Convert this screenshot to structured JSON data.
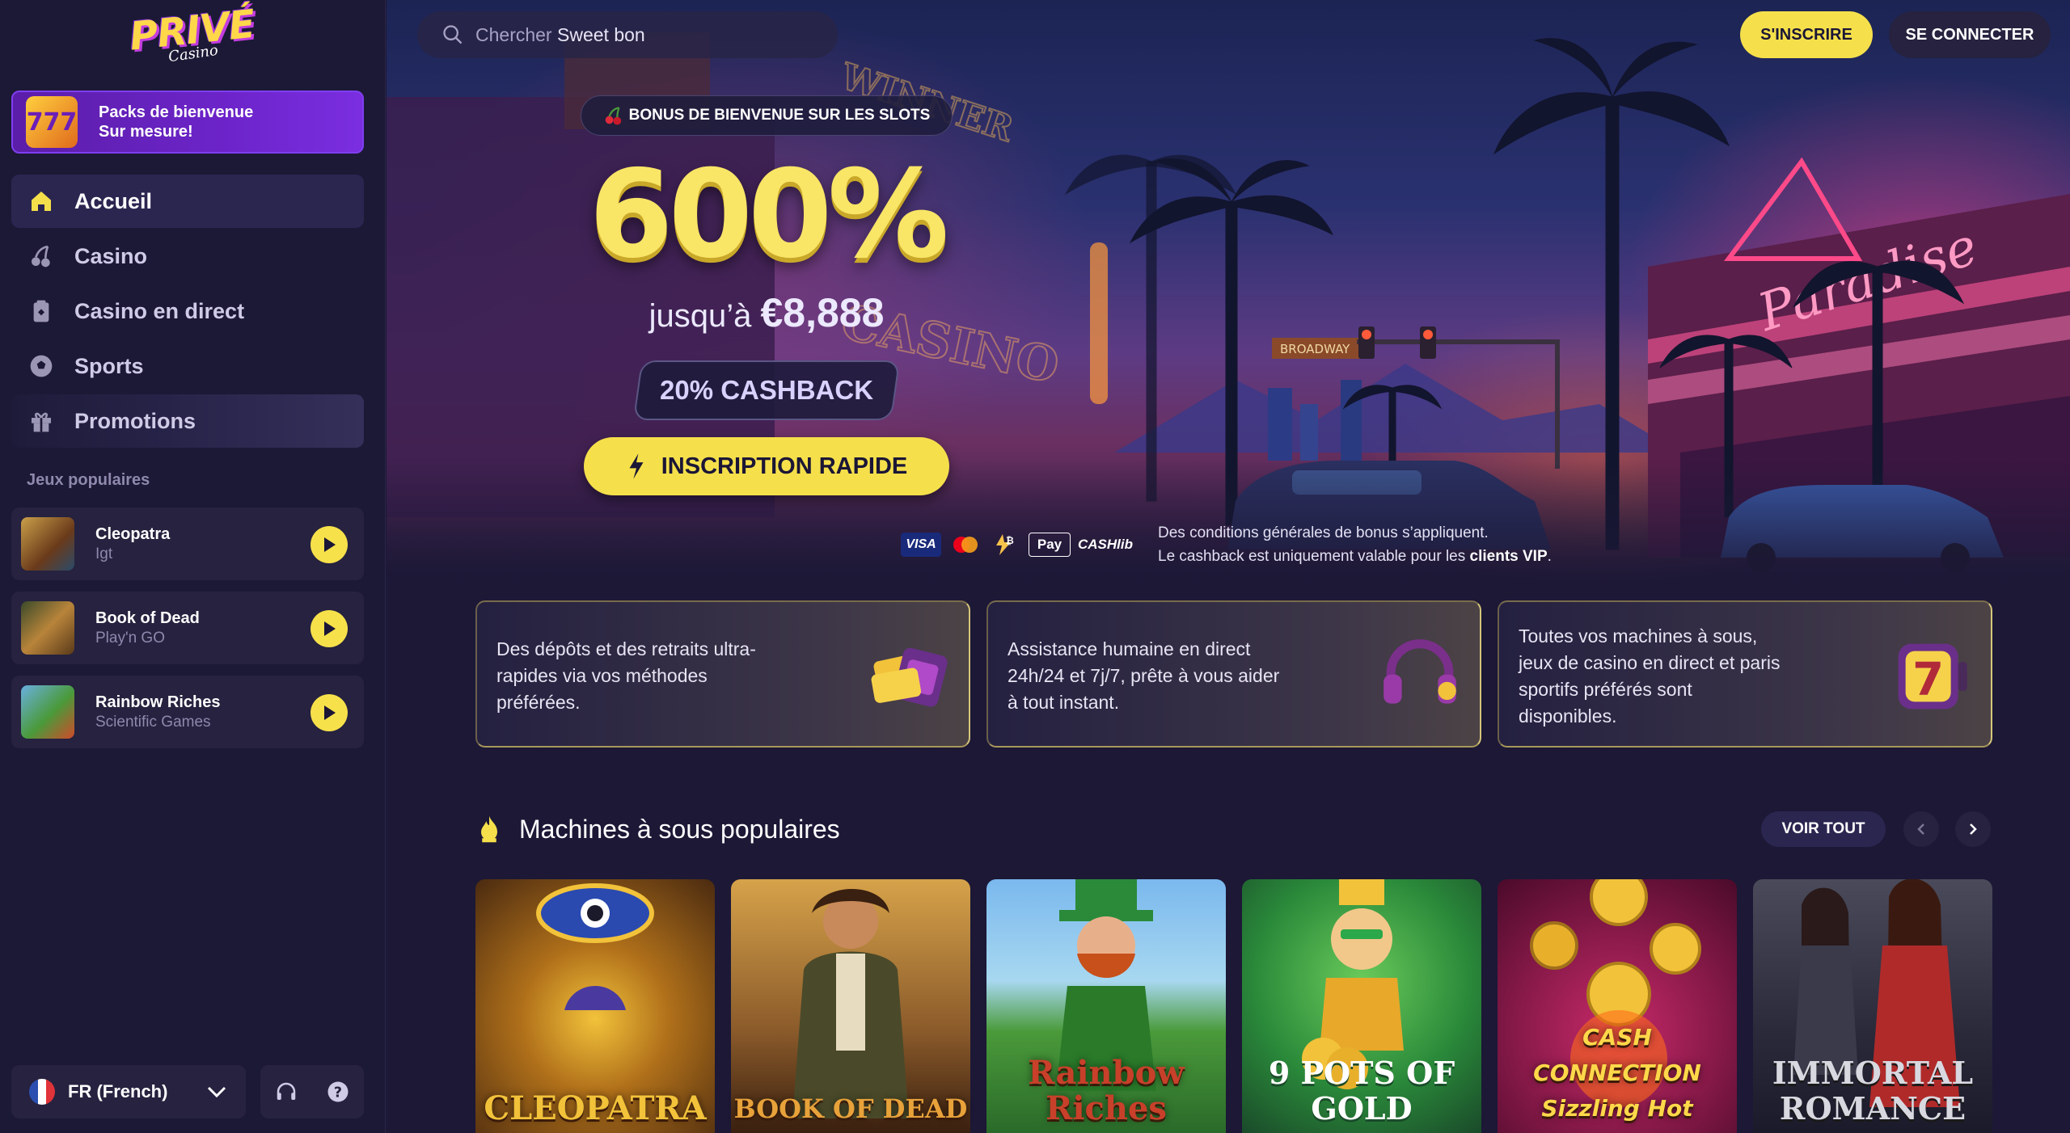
{
  "brand": {
    "logo_main": "PRIVÉ",
    "logo_sub": "Casino"
  },
  "sidebar": {
    "promo_banner": {
      "line1": "Packs de bienvenue",
      "line2": "Sur mesure!",
      "icon": "777-slot-icon"
    },
    "nav": [
      {
        "label": "Accueil",
        "icon": "home-icon",
        "active": true
      },
      {
        "label": "Casino",
        "icon": "cherry-icon"
      },
      {
        "label": "Casino en direct",
        "icon": "live-cards-icon"
      },
      {
        "label": "Sports",
        "icon": "soccer-ball-icon"
      },
      {
        "label": "Promotions",
        "icon": "gift-icon"
      }
    ],
    "popular_title": "Jeux populaires",
    "popular_games": [
      {
        "name": "Cleopatra",
        "provider": "Igt"
      },
      {
        "name": "Book of Dead",
        "provider": "Play'n GO"
      },
      {
        "name": "Rainbow Riches",
        "provider": "Scientific Games"
      }
    ],
    "language": "FR (French)"
  },
  "topbar": {
    "search_placeholder": "Chercher",
    "search_suggestion": "Sweet bon",
    "signup": "S'INSCRIRE",
    "login": "SE CONNECTER"
  },
  "hero": {
    "bonus_pill": "BONUS DE BIENVENUE SUR LES SLOTS",
    "percentage": "600%",
    "upto_prefix": "jusqu’à",
    "upto_amount": "€8,888",
    "cashback": "20% CASHBACK",
    "cta": "INSCRIPTION RAPIDE",
    "payments": [
      "VISA",
      "Mastercard",
      "Bitcoin",
      "Apple Pay",
      "CASHlib"
    ],
    "terms_line1": "Des conditions générales de bonus s’appliquent.",
    "terms_line2_prefix": "Le cashback est uniquement valable pour les",
    "terms_line2_bold": "clients VIP",
    "terms_line2_suffix": "."
  },
  "features": [
    {
      "text": "Des dépôts et des retraits ultra-rapides via vos méthodes préférées.",
      "icon": "wallet-card-icon"
    },
    {
      "text": "Assistance humaine en direct 24h/24 et 7j/7, prête à vous aider à tout instant.",
      "icon": "headset-icon"
    },
    {
      "text": "Toutes vos machines à sous, jeux de casino en direct et paris sportifs préférés sont disponibles.",
      "icon": "seven-slot-icon"
    }
  ],
  "popular_slots": {
    "title": "Machines à sous populaires",
    "see_all": "VOIR TOUT",
    "items": [
      {
        "title": "CLEOPATRA"
      },
      {
        "title": "BOOK OF DEAD"
      },
      {
        "title": "Rainbow Riches"
      },
      {
        "title": "9 POTS OF GOLD"
      },
      {
        "title": "CASH CONNECTION Sizzling Hot"
      },
      {
        "title": "IMMORTAL ROMANCE"
      }
    ]
  },
  "colors": {
    "accent_yellow": "#f5e04b",
    "bg": "#1c1836",
    "panel": "#26223f",
    "purple": "#6c24c9"
  }
}
